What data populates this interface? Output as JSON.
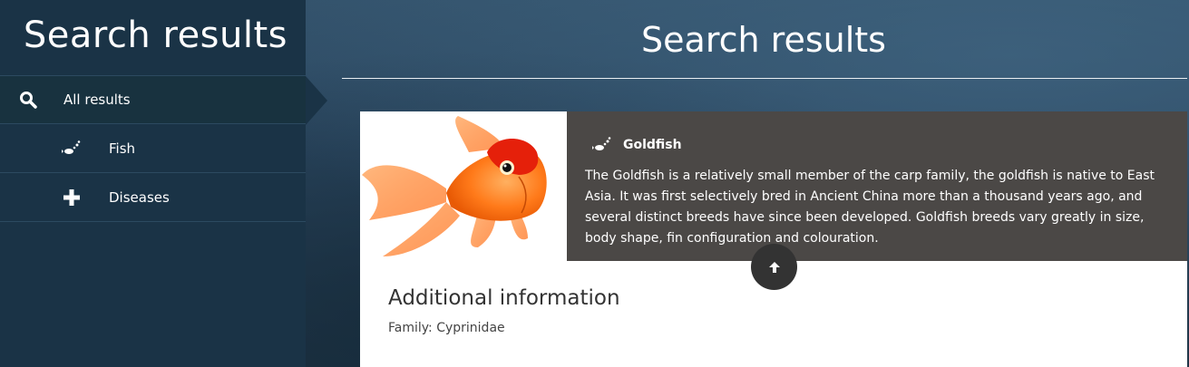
{
  "sidebar": {
    "title": "Search results",
    "items": [
      {
        "label": "All results",
        "icon": "search-icon"
      },
      {
        "label": "Fish",
        "icon": "fish-icon"
      },
      {
        "label": "Diseases",
        "icon": "plus-icon"
      }
    ]
  },
  "main": {
    "title": "Search results",
    "result": {
      "name": "Goldfish",
      "icon": "fish-icon",
      "description": "The Goldfish is a relatively small member of the carp family, the goldfish is native to East Asia. It was first selectively bred in Ancient China more than a thousand years ago, and several distinct breeds have since been developed. Goldfish breeds vary greatly in size, body shape, fin configuration and colouration.",
      "image": "goldfish-photo"
    },
    "additional": {
      "heading": "Additional information",
      "family": "Family: Cyprinidae"
    }
  },
  "colors": {
    "sidebar_bg": "#1a3346",
    "info_bg": "#4b4846",
    "scroll_button": "#333333"
  }
}
